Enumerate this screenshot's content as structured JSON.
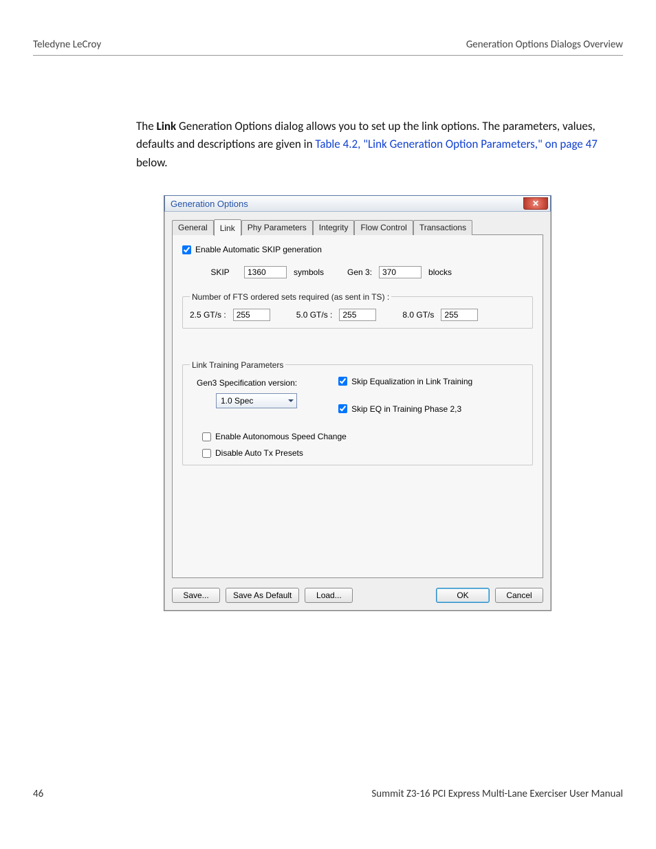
{
  "header": {
    "left": "Teledyne LeCroy",
    "right": "Generation Options Dialogs Overview"
  },
  "intro": {
    "pre": "The ",
    "bold": "Link",
    "mid": " Generation Options dialog allows you to set up the link options. The parameters, values, defaults and descriptions are given in ",
    "link": "Table 4.2, \"Link Generation Option Parameters,\" on page 47",
    "post": " below."
  },
  "dialog": {
    "title": "Generation Options",
    "tabs": [
      "General",
      "Link",
      "Phy Parameters",
      "Integrity",
      "Flow Control",
      "Transactions"
    ],
    "active_tab_index": 1,
    "panel": {
      "enable_skip_label": "Enable Automatic SKIP generation",
      "skip_label": "SKIP",
      "skip_value": "1360",
      "symbols_label": "symbols",
      "gen3_label": "Gen 3:",
      "gen3_value": "370",
      "blocks_label": "blocks",
      "fts_legend": "Number of FTS ordered sets required (as sent in TS) :",
      "fts": {
        "r25_label": "2.5 GT/s :",
        "r25_value": "255",
        "r50_label": "5.0 GT/s :",
        "r50_value": "255",
        "r80_label": "8.0 GT/s",
        "r80_value": "255"
      },
      "training_legend": "Link Training Parameters",
      "training": {
        "spec_label": "Gen3 Specification version:",
        "spec_value": "1.0 Spec",
        "skip_eq_label": "Skip Equalization in Link Training",
        "skip_eq_phase_label": "Skip EQ in Training Phase 2,3",
        "auton_speed_label": "Enable Autonomous Speed Change",
        "disable_tx_label": "Disable Auto Tx Presets"
      }
    },
    "buttons": {
      "save": "Save...",
      "save_default": "Save As Default",
      "load": "Load...",
      "ok": "OK",
      "cancel": "Cancel"
    }
  },
  "footer": {
    "page": "46",
    "manual": "Summit Z3-16 PCI Express Multi-Lane Exerciser User Manual"
  }
}
